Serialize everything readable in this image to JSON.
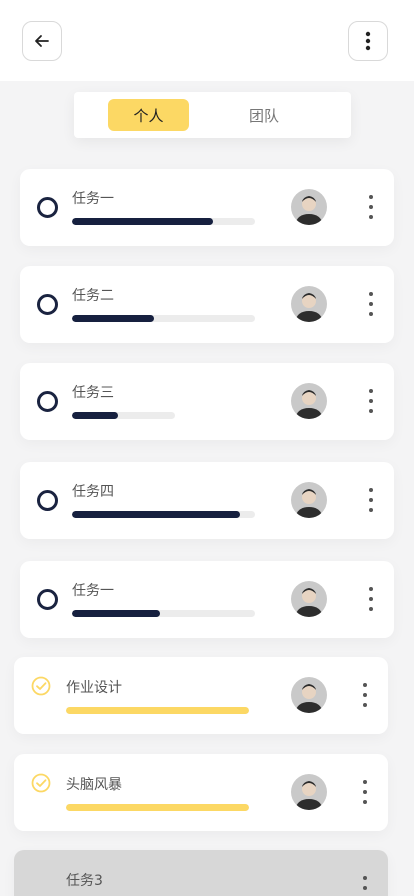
{
  "header": {
    "back_icon": "arrow-left-icon",
    "more_icon": "vertical-dots-icon"
  },
  "tabs": [
    {
      "label": "个人",
      "active": true
    },
    {
      "label": "团队",
      "active": false
    }
  ],
  "colors": {
    "accent": "#fcd864",
    "progress": "#16203f",
    "track": "#ececec"
  },
  "tasks": [
    {
      "title": "任务一",
      "status": "open",
      "progress": 0.77
    },
    {
      "title": "任务二",
      "status": "open",
      "progress": 0.45
    },
    {
      "title": "任务三",
      "status": "open",
      "progress": 0.45
    },
    {
      "title": "任务四",
      "status": "open",
      "progress": 0.92
    },
    {
      "title": "任务一",
      "status": "open",
      "progress": 0.48
    },
    {
      "title": "作业设计",
      "status": "done",
      "progress": 1.0
    },
    {
      "title": "头脑风暴",
      "status": "done",
      "progress": 1.0
    },
    {
      "title": "任务3",
      "status": "inactive",
      "progress": 0
    }
  ]
}
